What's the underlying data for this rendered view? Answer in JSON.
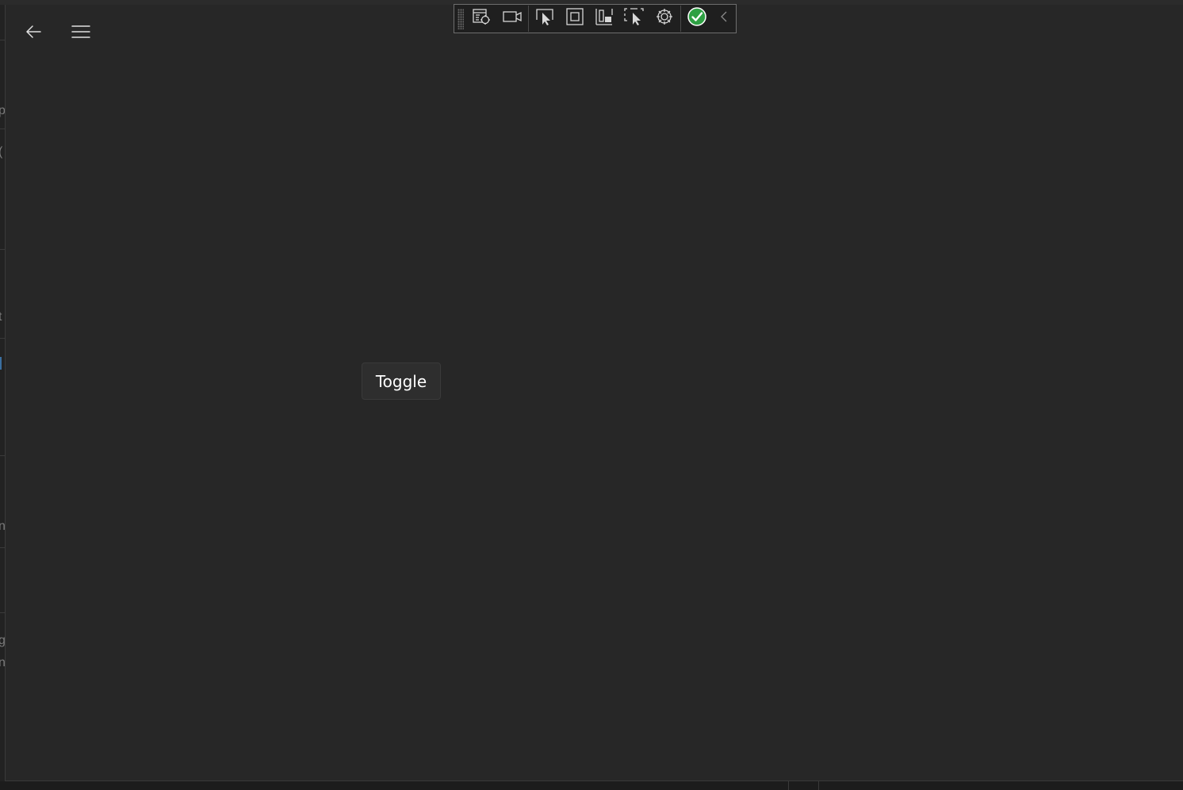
{
  "navigation": {
    "back_icon": "arrow-left-icon",
    "menu_icon": "hamburger-menu-icon"
  },
  "debug_toolbar": {
    "items": [
      {
        "name": "live-visual-tree-icon"
      },
      {
        "name": "record-video-icon"
      },
      {
        "name": "select-element-icon"
      },
      {
        "name": "display-layout-adorners-icon"
      },
      {
        "name": "track-focused-element-icon"
      },
      {
        "name": "preview-selection-icon"
      },
      {
        "name": "binding-failures-icon"
      },
      {
        "name": "accessibility-check-icon"
      },
      {
        "name": "collapse-toolbar-icon"
      }
    ],
    "status_color": "#2ea043"
  },
  "main": {
    "toggle_label": "Toggle"
  },
  "background_window": {
    "glyphs": [
      "p",
      "(",
      "t",
      "t",
      "n",
      "g",
      "n"
    ]
  }
}
